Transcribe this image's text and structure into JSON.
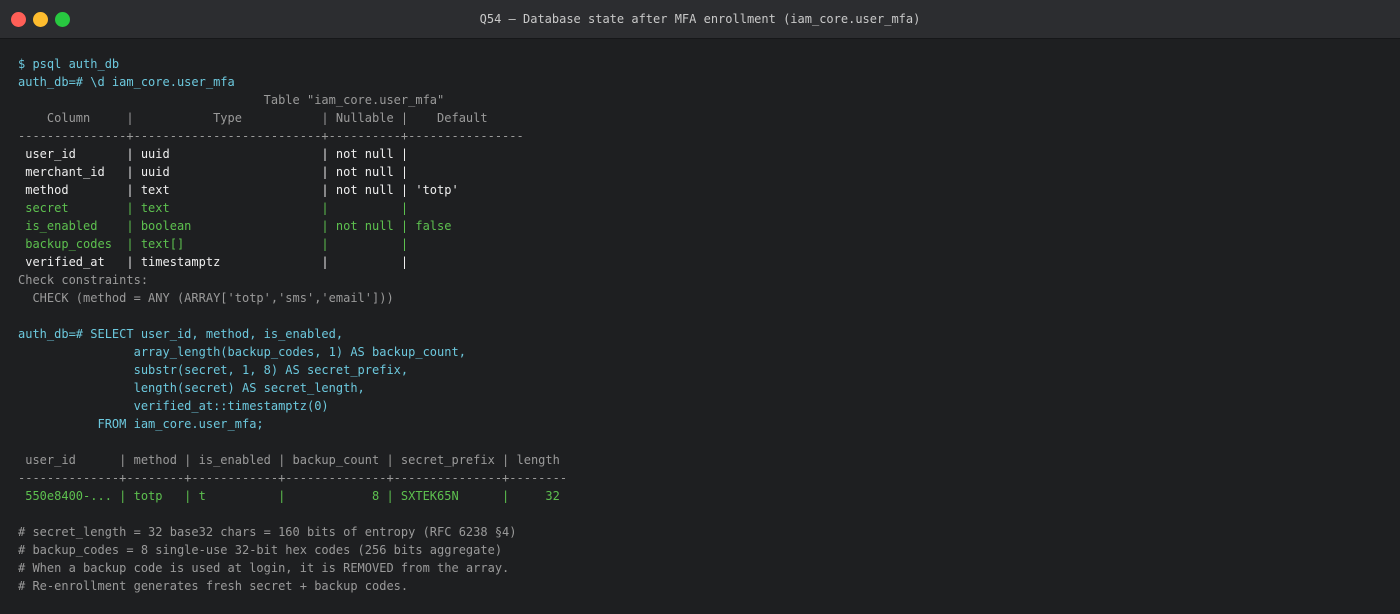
{
  "window": {
    "title": "Q54 — Database state after MFA enrollment (iam_core.user_mfa)"
  },
  "terminal": {
    "lines": [
      {
        "text": "$ psql auth_db",
        "color": "cyan"
      },
      {
        "text": "auth_db=# \\d iam_core.user_mfa",
        "color": "cyan"
      },
      {
        "text": "                                  Table \"iam_core.user_mfa\"",
        "color": "gray"
      },
      {
        "text": "    Column     |           Type           | Nullable |    Default",
        "color": "gray"
      },
      {
        "text": "---------------+--------------------------+----------+----------------",
        "color": "gray"
      },
      {
        "text": " user_id       | uuid                     | not null |",
        "color": "white"
      },
      {
        "text": " merchant_id   | uuid                     | not null |",
        "color": "white"
      },
      {
        "text": " method        | text                     | not null | 'totp'",
        "color": "white"
      },
      {
        "text": " secret        | text                     |          |",
        "color": "green"
      },
      {
        "text": " is_enabled    | boolean                  | not null | false",
        "color": "green"
      },
      {
        "text": " backup_codes  | text[]                   |          |",
        "color": "green"
      },
      {
        "text": " verified_at   | timestamptz              |          |",
        "color": "white"
      },
      {
        "text": "Check constraints:",
        "color": "gray"
      },
      {
        "text": "  CHECK (method = ANY (ARRAY['totp','sms','email']))",
        "color": "gray"
      },
      {
        "text": "",
        "color": "gray"
      },
      {
        "text": "auth_db=# SELECT user_id, method, is_enabled,",
        "color": "cyan"
      },
      {
        "text": "                array_length(backup_codes, 1) AS backup_count,",
        "color": "cyan"
      },
      {
        "text": "                substr(secret, 1, 8) AS secret_prefix,",
        "color": "cyan"
      },
      {
        "text": "                length(secret) AS secret_length,",
        "color": "cyan"
      },
      {
        "text": "                verified_at::timestamptz(0)",
        "color": "cyan"
      },
      {
        "text": "           FROM iam_core.user_mfa;",
        "color": "cyan"
      },
      {
        "text": "",
        "color": "gray"
      },
      {
        "text": " user_id      | method | is_enabled | backup_count | secret_prefix | length",
        "color": "gray"
      },
      {
        "text": "--------------+--------+------------+--------------+---------------+--------",
        "color": "gray"
      },
      {
        "text": " 550e8400-... | totp   | t          |            8 | SXTEK65N      |     32",
        "color": "green"
      },
      {
        "text": "",
        "color": "gray"
      },
      {
        "text": "# secret_length = 32 base32 chars = 160 bits of entropy (RFC 6238 §4)",
        "color": "gray"
      },
      {
        "text": "# backup_codes = 8 single-use 32-bit hex codes (256 bits aggregate)",
        "color": "gray"
      },
      {
        "text": "# When a backup code is used at login, it is REMOVED from the array.",
        "color": "gray"
      },
      {
        "text": "# Re-enrollment generates fresh secret + backup codes.",
        "color": "gray"
      }
    ]
  }
}
